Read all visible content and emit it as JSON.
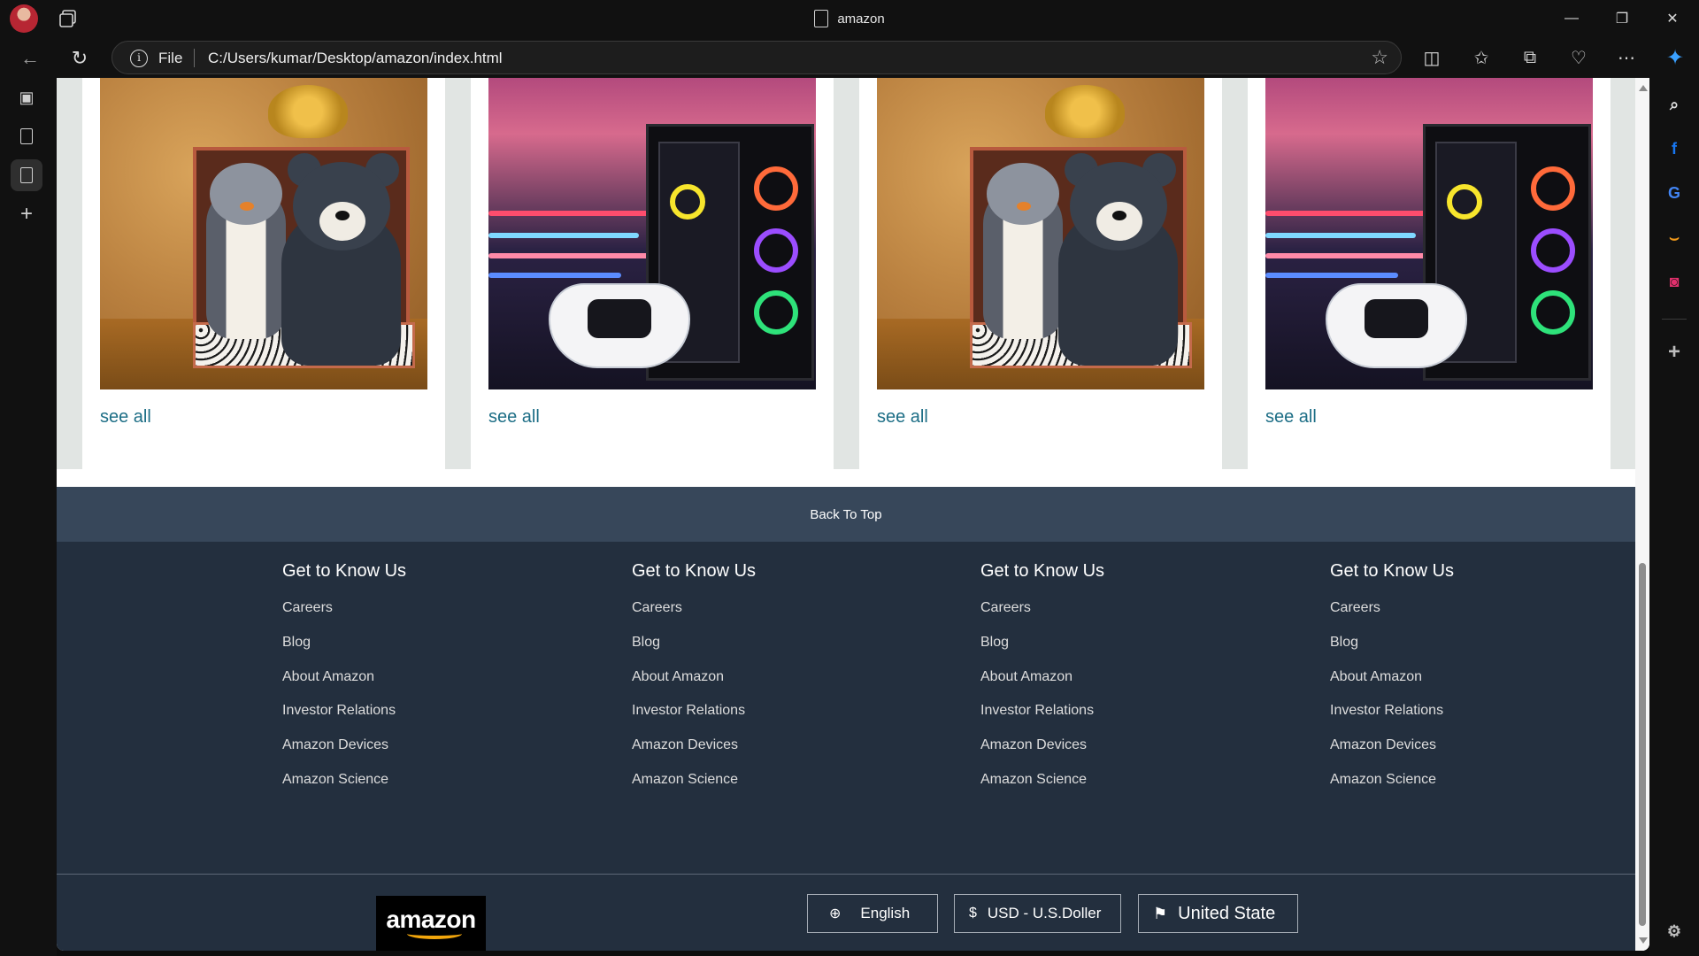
{
  "browser": {
    "tab_title": "amazon",
    "address_scheme": "File",
    "address_url": "C:/Users/kumar/Desktop/amazon/index.html",
    "window_controls": {
      "minimize": "—",
      "restore": "❐",
      "close": "✕"
    }
  },
  "cards": [
    {
      "image": "plush-toys-gift-box",
      "link": "see all"
    },
    {
      "image": "gaming-pc-controller",
      "link": "see all"
    },
    {
      "image": "plush-toys-gift-box",
      "link": "see all"
    },
    {
      "image": "gaming-pc-controller",
      "link": "see all"
    }
  ],
  "back_to_top": "Back To Top",
  "footer": {
    "columns": [
      {
        "heading": "Get to Know Us",
        "links": [
          "Careers",
          "Blog",
          "About Amazon",
          "Investor Relations",
          "Amazon Devices",
          "Amazon Science"
        ]
      },
      {
        "heading": "Get to Know Us",
        "links": [
          "Careers",
          "Blog",
          "About Amazon",
          "Investor Relations",
          "Amazon Devices",
          "Amazon Science"
        ]
      },
      {
        "heading": "Get to Know Us",
        "links": [
          "Careers",
          "Blog",
          "About Amazon",
          "Investor Relations",
          "Amazon Devices",
          "Amazon Science"
        ]
      },
      {
        "heading": "Get to Know Us",
        "links": [
          "Careers",
          "Blog",
          "About Amazon",
          "Investor Relations",
          "Amazon Devices",
          "Amazon Science"
        ]
      }
    ],
    "logo_text": "amazon",
    "language_button": {
      "icon": "globe-icon",
      "label": "English"
    },
    "currency_button": {
      "icon": "dollar-icon",
      "symbol": "$",
      "label": "USD - U.S.Doller"
    },
    "country_button": {
      "icon": "flag-icon",
      "label": "United State"
    }
  },
  "colors": {
    "footer_bg": "#232f3e",
    "back_to_top_bg": "#37475a",
    "link_teal": "#1d6e86",
    "logo_smile": "#f2a60c"
  }
}
